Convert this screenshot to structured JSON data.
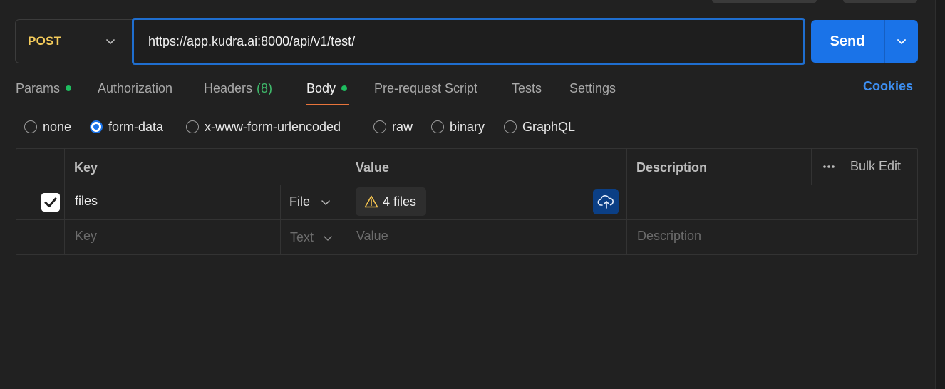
{
  "request": {
    "method": "POST",
    "url": "https://app.kudra.ai:8000/api/v1/test/",
    "send_label": "Send"
  },
  "tabs": [
    {
      "label": "Params",
      "dot": true
    },
    {
      "label": "Authorization"
    },
    {
      "label": "Headers",
      "count": "(8)"
    },
    {
      "label": "Body",
      "dot": true,
      "active": true
    },
    {
      "label": "Pre-request Script"
    },
    {
      "label": "Tests"
    },
    {
      "label": "Settings"
    }
  ],
  "cookies_label": "Cookies",
  "body_types": [
    {
      "label": "none",
      "selected": false
    },
    {
      "label": "form-data",
      "selected": true
    },
    {
      "label": "x-www-form-urlencoded",
      "selected": false
    },
    {
      "label": "raw",
      "selected": false
    },
    {
      "label": "binary",
      "selected": false
    },
    {
      "label": "GraphQL",
      "selected": false
    }
  ],
  "table": {
    "headers": {
      "key": "Key",
      "value": "Value",
      "description": "Description"
    },
    "bulk_edit": "Bulk Edit",
    "rows": [
      {
        "checked": true,
        "key": "files",
        "type": "File",
        "value": "4 files",
        "description": ""
      }
    ],
    "new_row": {
      "key_placeholder": "Key",
      "type": "Text",
      "value_placeholder": "Value",
      "description_placeholder": "Description"
    }
  },
  "colors": {
    "accent": "#1a73e8",
    "method": "#f5cc5b",
    "active_tab_underline": "#e8743b",
    "status_dot": "#1ebd5f",
    "warning": "#f2c14e"
  }
}
